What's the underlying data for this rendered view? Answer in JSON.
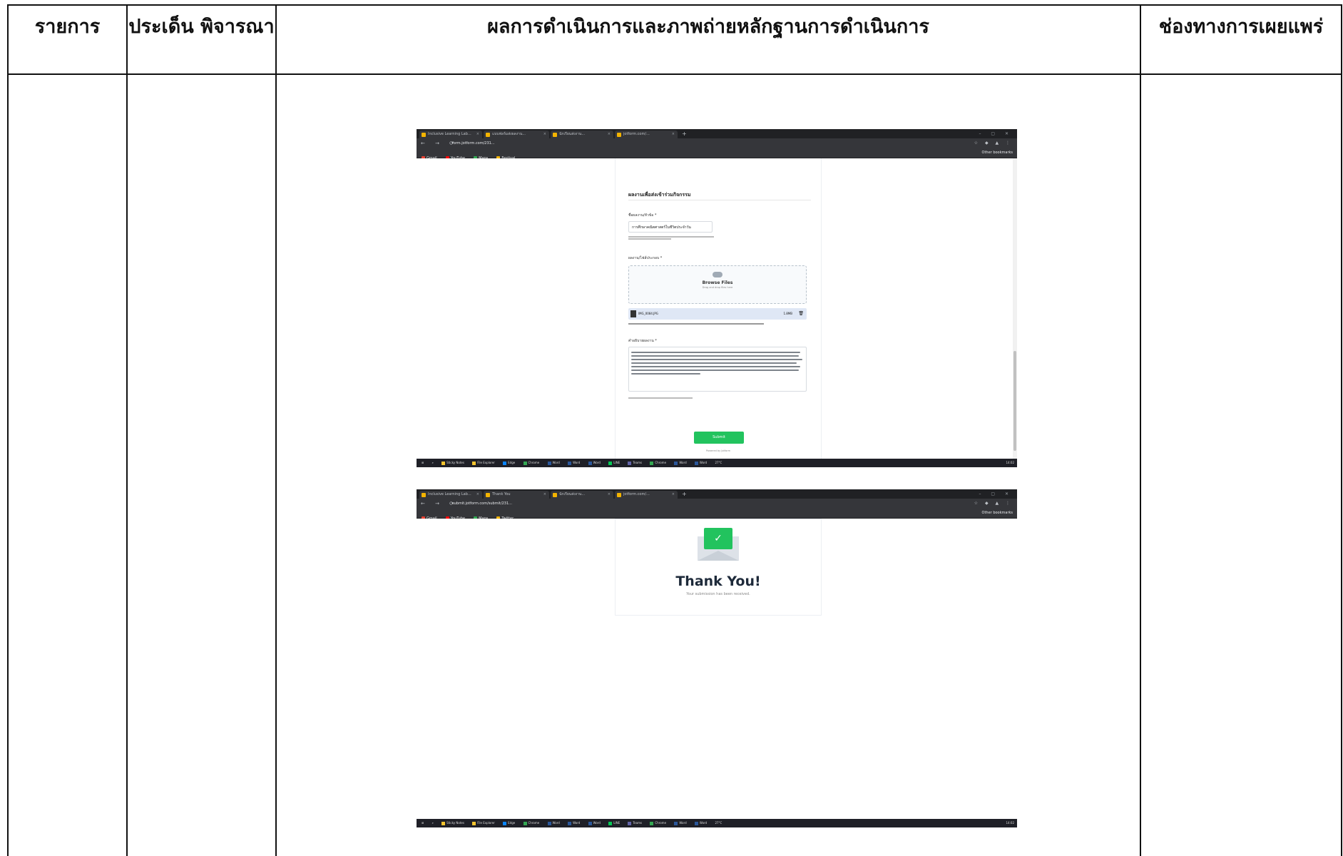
{
  "table": {
    "headers": {
      "col1": "รายการ",
      "col2": "ประเด็น พิจารณา",
      "col3": "ผลการดำเนินการและภาพถ่ายหลักฐานการดำเนินการ",
      "col4": "ช่องทางการเผยแพร่"
    }
  },
  "screenshot1": {
    "tabs": [
      "Inclusive Learning Lab...",
      "แบบฟอร์มส่งผลงาน...",
      "นักเรียนส่งงาน...",
      "jotform.com/..."
    ],
    "url": "form.jotform.com/231...",
    "bookmarks": [
      "Gmail",
      "YouTube",
      "Maps",
      "Festival"
    ],
    "bookmarks_right": "Other bookmarks",
    "form": {
      "section_title": "ผลงานเพื่อส่งเข้าร่วมกิจกรรม",
      "name_label": "ชื่อผลงาน/หัวข้อ *",
      "name_value": "การศึกษาคณิตศาสตร์ในชีวิตประจำวัน",
      "upload_label": "ผลงาน/ไฟล์ประกอบ *",
      "browse_files": "Browse Files",
      "drag_drop": "Drag and drop files here",
      "file_name": "IMG_0084.JPG",
      "file_size": "1.8MB",
      "desc_label": "คำอธิบายผลงาน *",
      "submit": "Submit",
      "powered_by": "Powered by Jotform"
    }
  },
  "screenshot2": {
    "tabs": [
      "Inclusive Learning Lab...",
      "Thank You",
      "นักเรียนส่งงาน...",
      "jotform.com/..."
    ],
    "url": "submit.jotform.com/submit/231...",
    "bookmarks": [
      "Gmail",
      "YouTube",
      "Maps",
      "Twitter"
    ],
    "bookmarks_right": "Other bookmarks",
    "thank_you_title": "Thank You!",
    "thank_you_sub": "Your submission has been received."
  },
  "taskbar": {
    "apps": [
      "Sticky Notes",
      "File Explorer",
      "Edge",
      "Chrome",
      "Word",
      "Word",
      "Word",
      "LINE",
      "Teams",
      "Chrome",
      "Word",
      "Word"
    ],
    "weather": "27°C",
    "time": "14:02"
  },
  "colors": {
    "accent_green": "#22c35e",
    "browser_dark": "#35363a"
  }
}
